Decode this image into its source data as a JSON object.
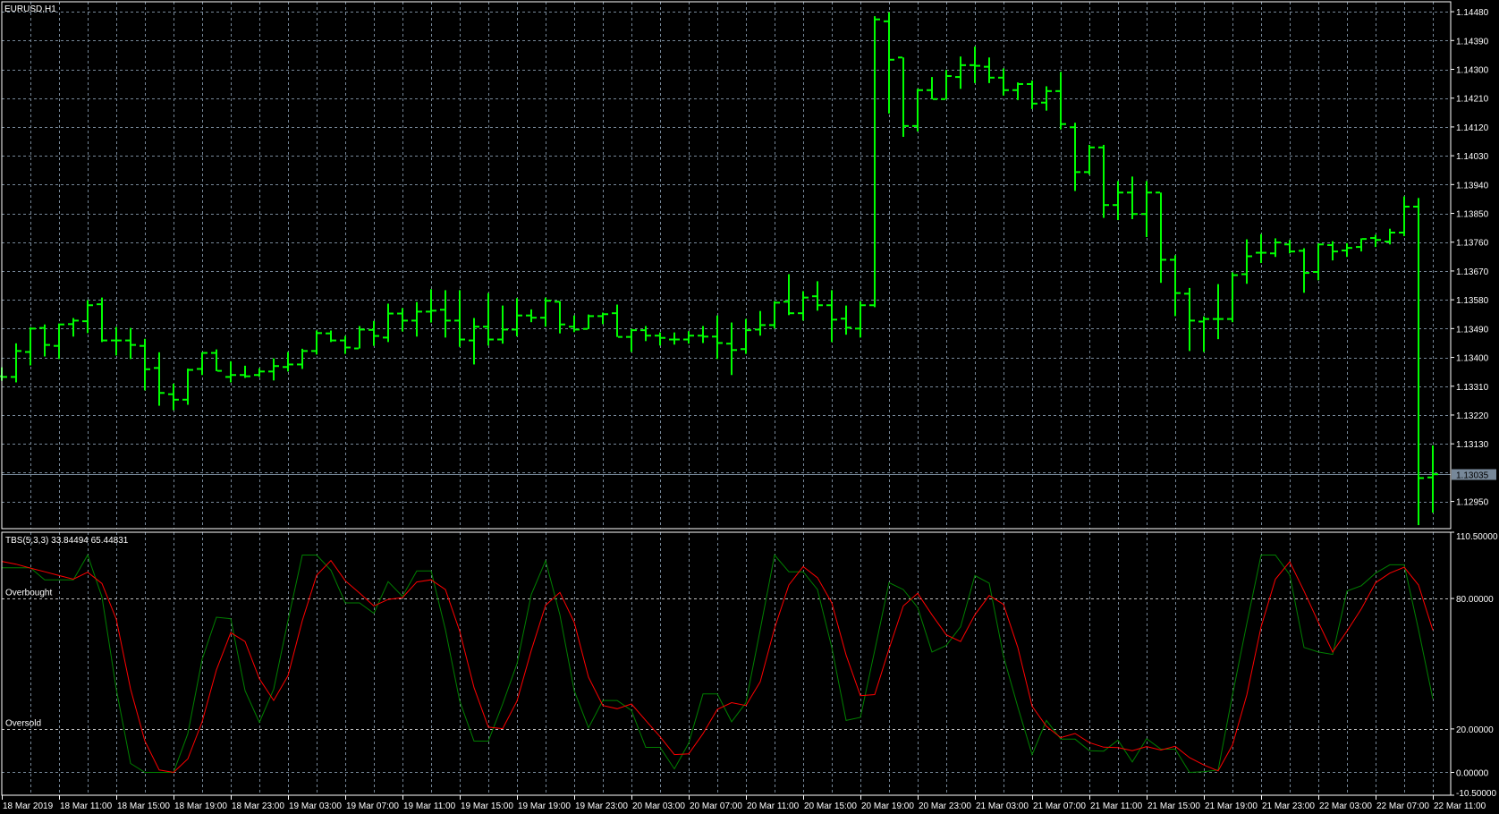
{
  "window": {
    "symbol_label": "EURUSD,H1"
  },
  "colors": {
    "background": "#000000",
    "grid": "#778899",
    "axis": "#ffffff",
    "bars": "#00ff00",
    "main_line": "#008000",
    "signal_line": "#ff0000",
    "level_line": "#c0c0c0",
    "current_price_bg": "#778899"
  },
  "chart_data": {
    "type": "ohlc",
    "title": "EURUSD,H1",
    "symbol": "EURUSD",
    "timeframe": "H1",
    "price_axis": {
      "ticks": [
        "1.14480",
        "1.14390",
        "1.14300",
        "1.14210",
        "1.14120",
        "1.14030",
        "1.13940",
        "1.13850",
        "1.13760",
        "1.13670",
        "1.13580",
        "1.13490",
        "1.13400",
        "1.13310",
        "1.13220",
        "1.13130",
        "1.12950"
      ],
      "grid_levels": [
        1.1448,
        1.1439,
        1.143,
        1.1421,
        1.1412,
        1.1403,
        1.1394,
        1.1385,
        1.1376,
        1.1367,
        1.1358,
        1.1349,
        1.134,
        1.1331,
        1.1322,
        1.1313,
        1.1304,
        1.1295
      ],
      "range": [
        1.12865,
        1.14511
      ]
    },
    "current_price": "1.13035",
    "time_axis": {
      "tick_every_bars": 4,
      "ticks": [
        "18 Mar 2019",
        "18 Mar 11:00",
        "18 Mar 15:00",
        "18 Mar 19:00",
        "18 Mar 23:00",
        "19 Mar 03:00",
        "19 Mar 07:00",
        "19 Mar 11:00",
        "19 Mar 15:00",
        "19 Mar 19:00",
        "19 Mar 23:00",
        "20 Mar 03:00",
        "20 Mar 07:00",
        "20 Mar 11:00",
        "20 Mar 15:00",
        "20 Mar 19:00",
        "20 Mar 23:00",
        "21 Mar 03:00",
        "21 Mar 07:00",
        "21 Mar 11:00",
        "21 Mar 15:00",
        "21 Mar 19:00",
        "21 Mar 23:00",
        "22 Mar 03:00",
        "22 Mar 07:00",
        "22 Mar 11:00"
      ]
    },
    "bars_format": [
      "open",
      "high",
      "low",
      "close"
    ],
    "bars": [
      [
        1.13341,
        1.13369,
        1.13327,
        1.13339
      ],
      [
        1.13339,
        1.13444,
        1.13322,
        1.1342
      ],
      [
        1.13417,
        1.13494,
        1.13375,
        1.1349
      ],
      [
        1.13492,
        1.13503,
        1.13403,
        1.13439
      ],
      [
        1.13436,
        1.13506,
        1.13395,
        1.13503
      ],
      [
        1.13504,
        1.13523,
        1.13465,
        1.13515
      ],
      [
        1.13513,
        1.13579,
        1.13476,
        1.13563
      ],
      [
        1.13566,
        1.13587,
        1.13448,
        1.13453
      ],
      [
        1.13453,
        1.13495,
        1.13406,
        1.13453
      ],
      [
        1.13453,
        1.13492,
        1.13395,
        1.13439
      ],
      [
        1.13436,
        1.13458,
        1.13297,
        1.13363
      ],
      [
        1.13367,
        1.13416,
        1.13249,
        1.13289
      ],
      [
        1.13285,
        1.13318,
        1.13235,
        1.13268
      ],
      [
        1.13268,
        1.13365,
        1.13252,
        1.13361
      ],
      [
        1.13364,
        1.13416,
        1.13345,
        1.13414
      ],
      [
        1.13414,
        1.13425,
        1.13357,
        1.13358
      ],
      [
        1.13339,
        1.13388,
        1.13322,
        1.13345
      ],
      [
        1.13345,
        1.13374,
        1.13336,
        1.13341
      ],
      [
        1.13345,
        1.13366,
        1.13339,
        1.13356
      ],
      [
        1.13356,
        1.13397,
        1.13328,
        1.13373
      ],
      [
        1.1337,
        1.13417,
        1.13356,
        1.13378
      ],
      [
        1.13378,
        1.13427,
        1.13364,
        1.1342
      ],
      [
        1.1342,
        1.13484,
        1.13409,
        1.13476
      ],
      [
        1.13475,
        1.13484,
        1.13448,
        1.13453
      ],
      [
        1.13453,
        1.13467,
        1.13411,
        1.13431
      ],
      [
        1.13428,
        1.13498,
        1.13428,
        1.13487
      ],
      [
        1.13486,
        1.13514,
        1.13436,
        1.13467
      ],
      [
        1.13462,
        1.13568,
        1.13448,
        1.13537
      ],
      [
        1.13537,
        1.13554,
        1.13481,
        1.13515
      ],
      [
        1.13515,
        1.13573,
        1.13465,
        1.13543
      ],
      [
        1.13543,
        1.13613,
        1.13509,
        1.13546
      ],
      [
        1.13549,
        1.1361,
        1.13462,
        1.13515
      ],
      [
        1.13515,
        1.1361,
        1.13433,
        1.13456
      ],
      [
        1.13453,
        1.13523,
        1.13378,
        1.13496
      ],
      [
        1.13496,
        1.13601,
        1.13437,
        1.13456
      ],
      [
        1.13456,
        1.13562,
        1.13443,
        1.13487
      ],
      [
        1.13487,
        1.13585,
        1.13466,
        1.13531
      ],
      [
        1.13531,
        1.1355,
        1.1351,
        1.13524
      ],
      [
        1.13524,
        1.13587,
        1.13496,
        1.13577
      ],
      [
        1.13574,
        1.13576,
        1.13475,
        1.13503
      ],
      [
        1.13496,
        1.13531,
        1.13479,
        1.13487
      ],
      [
        1.13489,
        1.13534,
        1.13489,
        1.13529
      ],
      [
        1.13529,
        1.1354,
        1.13504,
        1.13535
      ],
      [
        1.13538,
        1.13565,
        1.13464,
        1.13464
      ],
      [
        1.13464,
        1.13489,
        1.13417,
        1.13485
      ],
      [
        1.13485,
        1.13498,
        1.13451,
        1.13468
      ],
      [
        1.13468,
        1.13478,
        1.13437,
        1.13461
      ],
      [
        1.13456,
        1.13478,
        1.1344,
        1.13456
      ],
      [
        1.13456,
        1.13482,
        1.13443,
        1.13468
      ],
      [
        1.13468,
        1.13498,
        1.13445,
        1.13465
      ],
      [
        1.13465,
        1.13531,
        1.13395,
        1.13445
      ],
      [
        1.13443,
        1.13509,
        1.13345,
        1.13423
      ],
      [
        1.13426,
        1.1352,
        1.13411,
        1.13485
      ],
      [
        1.13487,
        1.13545,
        1.13468,
        1.13501
      ],
      [
        1.13501,
        1.13576,
        1.1349,
        1.13571
      ],
      [
        1.13574,
        1.1366,
        1.13532,
        1.13538
      ],
      [
        1.13538,
        1.13607,
        1.13515,
        1.13587
      ],
      [
        1.13591,
        1.13638,
        1.13546,
        1.13563
      ],
      [
        1.13563,
        1.1361,
        1.13448,
        1.13518
      ],
      [
        1.13521,
        1.13562,
        1.13471,
        1.13493
      ],
      [
        1.1349,
        1.13576,
        1.13462,
        1.13563
      ],
      [
        1.13563,
        1.14466,
        1.13557,
        1.14456
      ],
      [
        1.1445,
        1.14478,
        1.14162,
        1.1433
      ],
      [
        1.14337,
        1.14337,
        1.14089,
        1.14123
      ],
      [
        1.14123,
        1.14239,
        1.14106,
        1.14235
      ],
      [
        1.14235,
        1.14276,
        1.14207,
        1.14207
      ],
      [
        1.14207,
        1.14298,
        1.14207,
        1.14279
      ],
      [
        1.14276,
        1.1434,
        1.14239,
        1.14313
      ],
      [
        1.14313,
        1.14371,
        1.14257,
        1.14311
      ],
      [
        1.14308,
        1.14337,
        1.14257,
        1.14274
      ],
      [
        1.14274,
        1.14303,
        1.14218,
        1.14235
      ],
      [
        1.14235,
        1.14259,
        1.14204,
        1.14254
      ],
      [
        1.14254,
        1.14265,
        1.14176,
        1.14193
      ],
      [
        1.14196,
        1.14247,
        1.14171,
        1.14232
      ],
      [
        1.14232,
        1.14292,
        1.14112,
        1.14129
      ],
      [
        1.14119,
        1.14133,
        1.1392,
        1.13979
      ],
      [
        1.13979,
        1.14064,
        1.13971,
        1.14056
      ],
      [
        1.14056,
        1.14064,
        1.13836,
        1.13876
      ],
      [
        1.13876,
        1.13951,
        1.13829,
        1.13915
      ],
      [
        1.13915,
        1.13965,
        1.13832,
        1.13848
      ],
      [
        1.13848,
        1.13951,
        1.13776,
        1.13915
      ],
      [
        1.13915,
        1.13915,
        1.13633,
        1.13705
      ],
      [
        1.13705,
        1.13719,
        1.13529,
        1.13601
      ],
      [
        1.13599,
        1.13617,
        1.1342,
        1.13515
      ],
      [
        1.13512,
        1.13528,
        1.13417,
        1.1352
      ],
      [
        1.1352,
        1.13629,
        1.13457,
        1.1352
      ],
      [
        1.1352,
        1.13666,
        1.1351,
        1.13657
      ],
      [
        1.1366,
        1.13769,
        1.1363,
        1.13716
      ],
      [
        1.13727,
        1.13785,
        1.13695,
        1.13727
      ],
      [
        1.13725,
        1.13772,
        1.13714,
        1.13759
      ],
      [
        1.13753,
        1.13767,
        1.13725,
        1.13731
      ],
      [
        1.13733,
        1.13741,
        1.13602,
        1.13664
      ],
      [
        1.13667,
        1.13756,
        1.13641,
        1.13753
      ],
      [
        1.13751,
        1.13763,
        1.13703,
        1.13731
      ],
      [
        1.13734,
        1.13757,
        1.13714,
        1.13742
      ],
      [
        1.13745,
        1.13772,
        1.13731,
        1.1377
      ],
      [
        1.13773,
        1.13783,
        1.13745,
        1.13767
      ],
      [
        1.13762,
        1.13802,
        1.13753,
        1.1379
      ],
      [
        1.1379,
        1.13903,
        1.13779,
        1.13871
      ],
      [
        1.13871,
        1.13898,
        1.12876,
        1.13023
      ],
      [
        1.13025,
        1.13125,
        1.12915,
        1.13035
      ]
    ],
    "indicator": {
      "title": "TBS(5,3,3) 33.84494 65.44831",
      "range": [
        -10.5,
        110.5
      ],
      "axis_ticks": [
        {
          "value": 110.5,
          "label": "110.50000"
        },
        {
          "value": 80,
          "label": "80.00000"
        },
        {
          "value": 20,
          "label": "20.00000"
        },
        {
          "value": 0,
          "label": "0.00000"
        },
        {
          "value": -10.5,
          "label": "-10.50000"
        }
      ],
      "levels": [
        {
          "value": 80,
          "label": "Overbought"
        },
        {
          "value": 20,
          "label": "Oversold"
        }
      ],
      "series": [
        {
          "name": "main",
          "color": "#008000",
          "values": [
            94.1,
            94.1,
            94.1,
            88.6,
            88.6,
            88.6,
            100,
            80.7,
            38.3,
            4.1,
            0,
            0,
            0,
            17.8,
            52.0,
            71.4,
            70.7,
            37.6,
            23.0,
            38.3,
            69.8,
            100,
            100,
            93.0,
            78.0,
            78.0,
            73.2,
            87.8,
            81.0,
            92.7,
            92.7,
            65.7,
            32.8,
            14.4,
            14.4,
            31.5,
            49.9,
            81.8,
            97.4,
            72.5,
            37.6,
            20.5,
            33.1,
            33.1,
            28.5,
            11.5,
            11.5,
            1.6,
            13.4,
            36.1,
            36.1,
            23.3,
            32.1,
            65.7,
            100,
            92.3,
            92.3,
            84.1,
            57.5,
            23.9,
            25.3,
            56.1,
            87.3,
            84.1,
            75.9,
            55.4,
            58.4,
            67.0,
            90.6,
            87.1,
            53.4,
            30.1,
            8.2,
            23.9,
            15.3,
            15.3,
            10.0,
            9.8,
            14.8,
            4.8,
            15.5,
            10.7,
            10.7,
            0,
            0.3,
            1.1,
            35.6,
            68.4,
            100,
            100,
            91.0,
            57.5,
            55.4,
            54.3,
            83.4,
            85.9,
            91.7,
            95.5,
            95.5,
            65.7,
            33.84494
          ]
        },
        {
          "name": "signal",
          "color": "#ff0000",
          "values": [
            97.1,
            95.8,
            94.0,
            92.3,
            90.6,
            88.9,
            92.1,
            86.9,
            70.5,
            38.3,
            14.4,
            1.1,
            0,
            6.2,
            23.3,
            47.2,
            64.3,
            60.2,
            43.1,
            33.1,
            44.5,
            69.8,
            90.7,
            97.5,
            88.2,
            82.5,
            76.6,
            79.6,
            80.4,
            87.6,
            88.6,
            84.1,
            65.0,
            39.0,
            20.8,
            20.1,
            32.8,
            56.1,
            76.9,
            82.8,
            69.1,
            43.8,
            30.8,
            29.3,
            31.5,
            23.9,
            16.4,
            8.2,
            8.5,
            17.8,
            29.0,
            32.1,
            30.8,
            41.7,
            66.3,
            86.2,
            94.7,
            89.6,
            78.0,
            54.0,
            35.3,
            35.8,
            56.8,
            76.6,
            82.4,
            72.5,
            63.3,
            60.2,
            72.5,
            81.4,
            77.3,
            57.5,
            30.4,
            21.2,
            16.0,
            17.9,
            13.7,
            11.6,
            11.4,
            10.0,
            11.9,
            10.3,
            12.0,
            6.8,
            3.4,
            0.7,
            12.6,
            35.6,
            67.0,
            88.9,
            96.9,
            83.4,
            69.1,
            55.4,
            65.0,
            75.2,
            87.3,
            91.7,
            94.4,
            86.2,
            65.44831
          ]
        }
      ]
    }
  }
}
